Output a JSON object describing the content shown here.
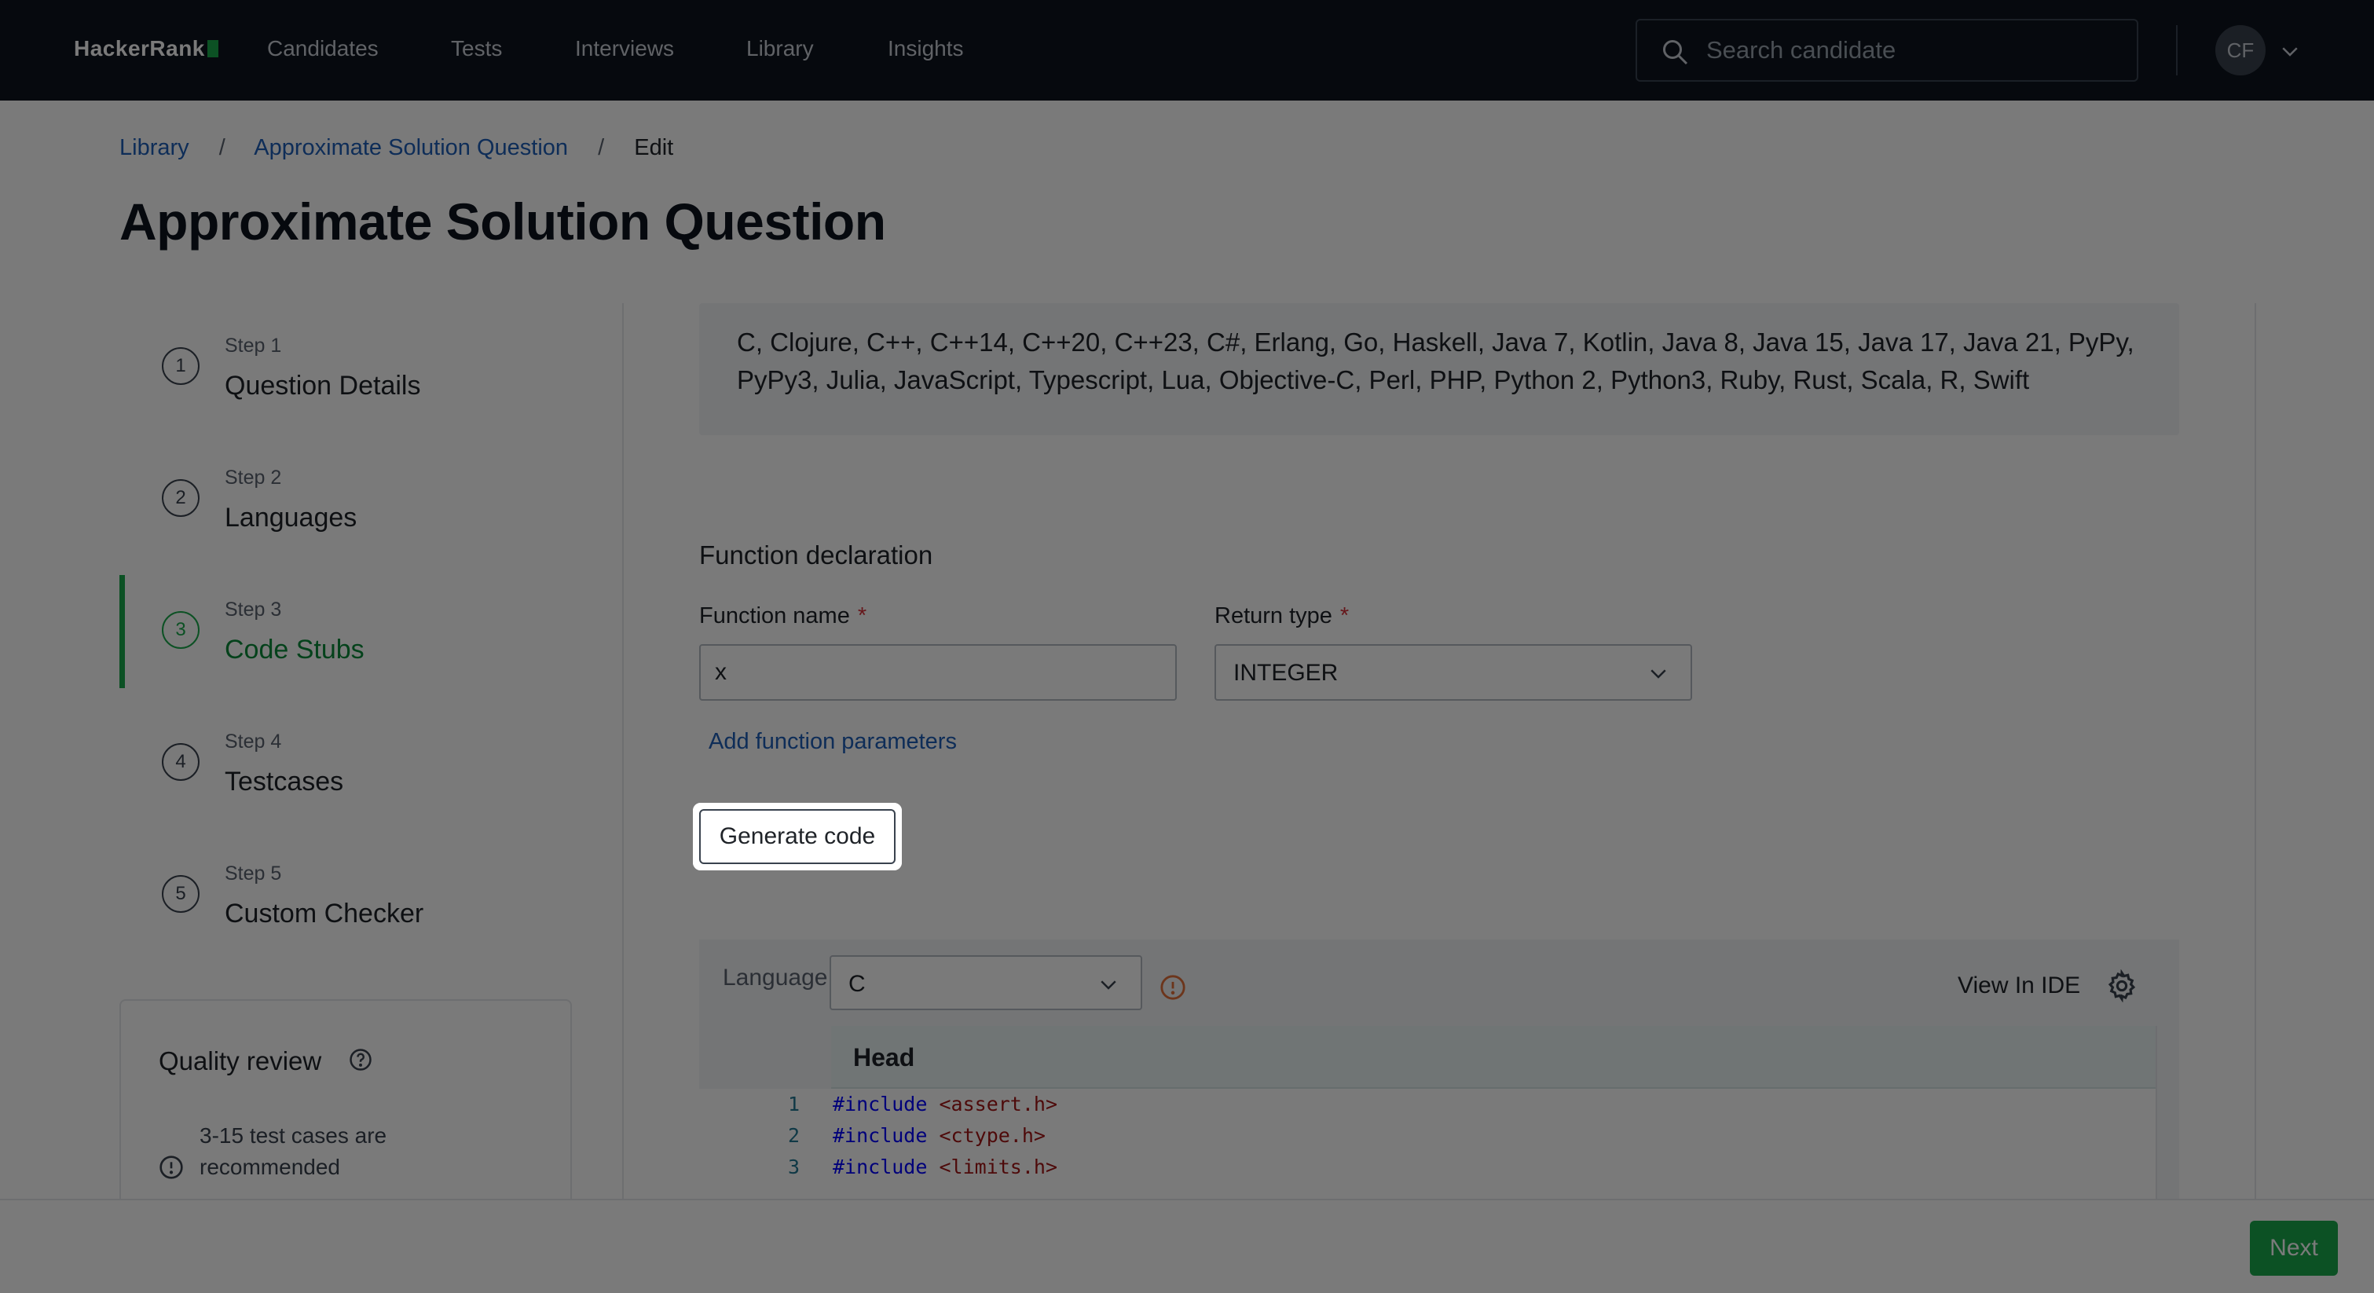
{
  "nav": {
    "logo": "HackerRank",
    "items": [
      "Candidates",
      "Tests",
      "Interviews",
      "Library",
      "Insights"
    ],
    "search_placeholder": "Search candidate",
    "avatar_initials": "CF"
  },
  "breadcrumb": {
    "items": [
      "Library",
      "Approximate Solution Question",
      "Edit"
    ]
  },
  "page_title": "Approximate Solution Question",
  "steps": [
    {
      "number": "1",
      "small": "Step 1",
      "name": "Question Details"
    },
    {
      "number": "2",
      "small": "Step 2",
      "name": "Languages"
    },
    {
      "number": "3",
      "small": "Step 3",
      "name": "Code Stubs",
      "active": true
    },
    {
      "number": "4",
      "small": "Step 4",
      "name": "Testcases"
    },
    {
      "number": "5",
      "small": "Step 5",
      "name": "Custom Checker"
    }
  ],
  "quality_review": {
    "title": "Quality review",
    "item": "3-15 test cases are recommended"
  },
  "languages": {
    "list": "C, Clojure, C++, C++14, C++20, C++23, C#, Erlang, Go, Haskell, Java 7, Kotlin, Java 8, Java 15, Java 17, Java 21, PyPy, PyPy3, Julia, JavaScript, Typescript, Lua, Objective-C, Perl, PHP, Python 2, Python3, Ruby, Rust, Scala, R, Swift"
  },
  "function_declaration": {
    "heading": "Function declaration",
    "name_label": "Function name",
    "name_value": "x",
    "return_label": "Return type",
    "return_value": "INTEGER",
    "required_mark": "*",
    "add_params": "Add function parameters",
    "generate_button": "Generate code"
  },
  "code_panel": {
    "language_label": "Language",
    "language_value": "C",
    "view_in_ide": "View In IDE",
    "section_label": "Head",
    "lines": [
      {
        "n": "1",
        "kw": "#include",
        "str": "<assert.h>"
      },
      {
        "n": "2",
        "kw": "#include",
        "str": "<ctype.h>"
      },
      {
        "n": "3",
        "kw": "#include",
        "str": "<limits.h>"
      }
    ]
  },
  "footer": {
    "next_label": "Next"
  },
  "colors": {
    "nav_bg": "#0e141e",
    "accent_green": "#1ba94c",
    "link_blue": "#1f5fb8",
    "required_red": "#d6313a"
  }
}
